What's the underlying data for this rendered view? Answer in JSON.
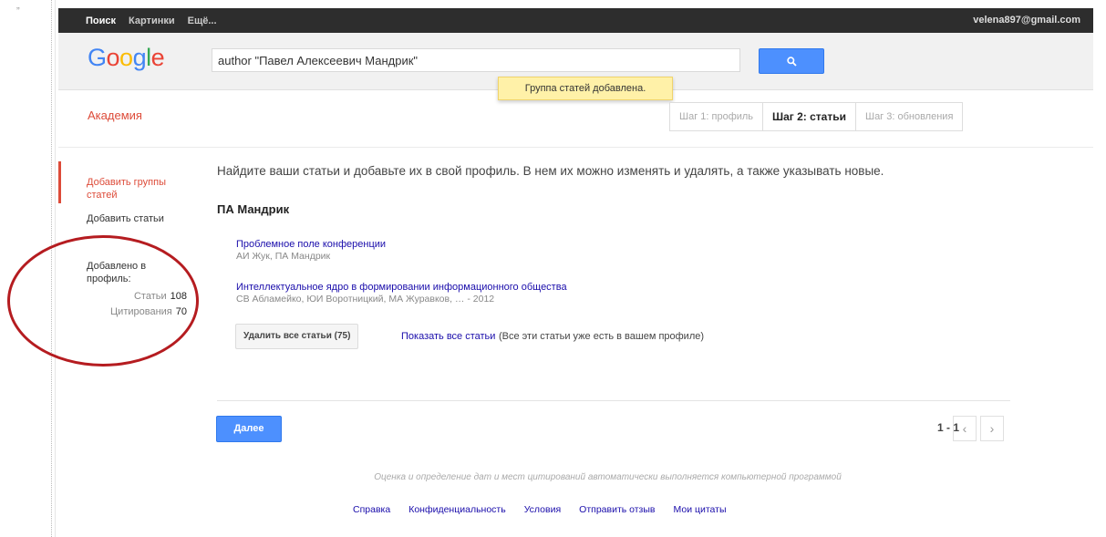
{
  "corner_quote": "„",
  "topbar": {
    "nav": [
      "Поиск",
      "Картинки",
      "Ещё..."
    ],
    "email": "velena897@gmail.com"
  },
  "header": {
    "logo": {
      "G": "G",
      "o1": "o",
      "o2": "o",
      "g": "g",
      "l": "l",
      "e": "e"
    },
    "search_value": "author \"Павел Алексеевич Мандрик\"",
    "search_icon": "magnifier-icon",
    "toast": "Группа статей добавлена."
  },
  "academy": {
    "title": "Академия",
    "steps": [
      "Шаг 1: профиль",
      "Шаг 2: статьи",
      "Шаг 3: обновления"
    ]
  },
  "sidebar": {
    "add_groups": "Добавить группы статей",
    "add_articles": "Добавить статьи",
    "added_label": "Добавлено в профиль:",
    "stats": [
      {
        "label": "Статьи",
        "value": "108"
      },
      {
        "label": "Цитирования",
        "value": "70"
      }
    ]
  },
  "main": {
    "intro": "Найдите ваши статьи и добавьте их в свой профиль. В нем их можно изменять и удалять, а также указывать новые.",
    "author": "ПА Мандрик",
    "articles": [
      {
        "title": "Проблемное поле конференции",
        "meta": "АИ Жук, ПА Мандрик"
      },
      {
        "title": "Интеллектуальное ядро в формировании информационного общества",
        "meta": "СВ Абламейко, ЮИ Воротницкий, МА Журавков, … - 2012"
      }
    ],
    "delete_all": "Удалить все статьи (75)",
    "show_all": "Показать все статьи",
    "note": "(Все эти статьи уже есть в вашем профиле)",
    "next": "Далее",
    "pager": "1 - 1",
    "prev_icon": "‹",
    "next_icon": "›"
  },
  "footer": {
    "disclaimer": "Оценка и определение дат и мест цитирований автоматически выполняется компьютерной программой",
    "links": [
      "Справка",
      "Конфиденциальность",
      "Условия",
      "Отправить отзыв",
      "Мои цитаты"
    ]
  },
  "colors": {
    "accent": "#4d90fe",
    "brand_red": "#dd4b39",
    "annotation": "#b51c20"
  }
}
